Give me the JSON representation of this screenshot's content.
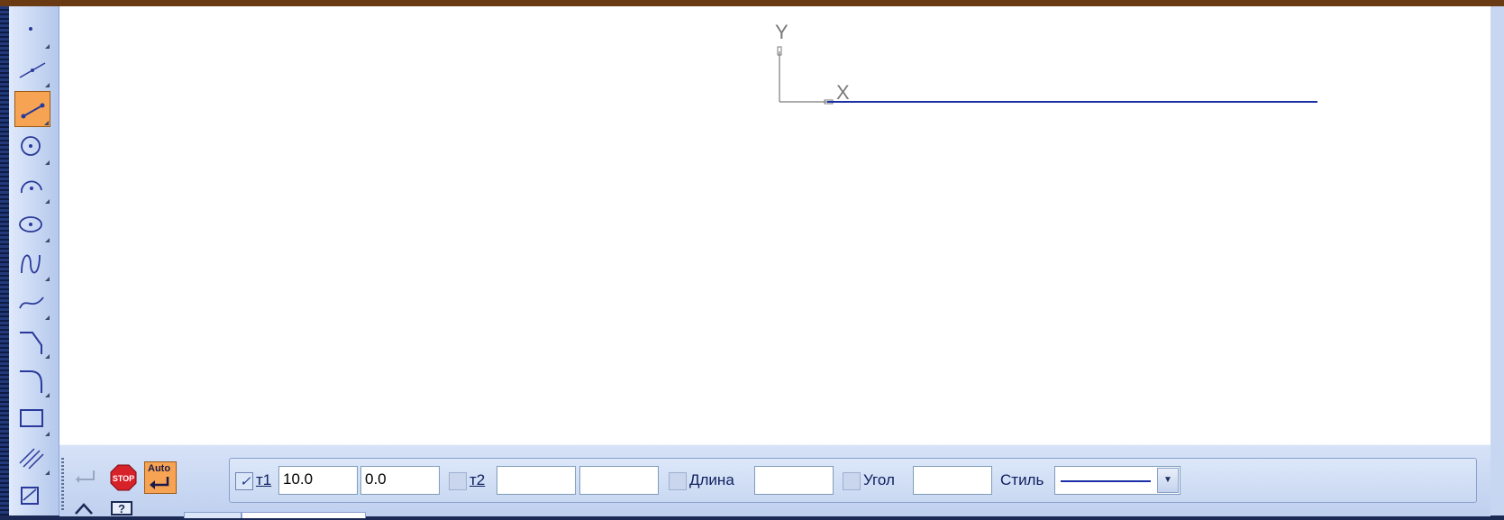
{
  "canvas": {
    "axis_x_label": "X",
    "axis_y_label": "Y",
    "line_color": "#1a2fa8"
  },
  "toolbar": {
    "tools": [
      {
        "icon": "point-icon"
      },
      {
        "icon": "auxiliary-line-icon"
      },
      {
        "icon": "segment-icon",
        "active": true
      },
      {
        "icon": "circle-icon"
      },
      {
        "icon": "arc-icon"
      },
      {
        "icon": "ellipse-icon"
      },
      {
        "icon": "nurbs-icon"
      },
      {
        "icon": "bezier-icon"
      },
      {
        "icon": "chamfer-icon"
      },
      {
        "icon": "fillet-icon"
      },
      {
        "icon": "rectangle-icon"
      },
      {
        "icon": "hatch-icon"
      },
      {
        "icon": "equidistant-icon"
      }
    ]
  },
  "propbar": {
    "enter_icon": "enter-arrow-icon",
    "stop_label": "STOP",
    "auto_label": "Auto",
    "t1_label": "т1",
    "t1_x": "10.0",
    "t1_y": "0.0",
    "t2_label": "т2",
    "t2_x": "",
    "t2_y": "",
    "length_label": "Длина",
    "length_value": "",
    "angle_label": "Угол",
    "angle_value": "",
    "style_label": "Стиль",
    "style_selected": "solid-line",
    "help_label": "?"
  }
}
